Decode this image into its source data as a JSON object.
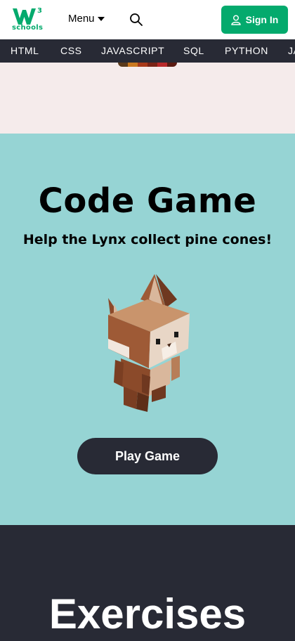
{
  "header": {
    "logo_word": "schools",
    "menu_label": "Menu",
    "signin_label": "Sign In",
    "brand_color": "#04AA6D"
  },
  "nav": {
    "items": [
      "HTML",
      "CSS",
      "JAVASCRIPT",
      "SQL",
      "PYTHON",
      "JA"
    ]
  },
  "game": {
    "title": "Code Game",
    "subtitle": "Help the Lynx collect pine cones!",
    "button": "Play Game",
    "background": "#96D4D4"
  },
  "exercises": {
    "title": "Exercises"
  },
  "icons": {
    "search": "search-icon",
    "user": "user-icon",
    "caret": "caret-down-icon",
    "mascot": "lynx-illustration"
  }
}
